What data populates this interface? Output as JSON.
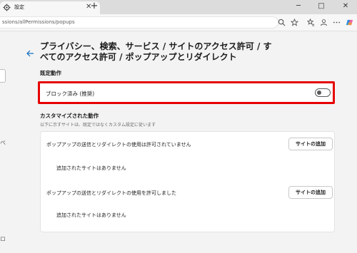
{
  "tab": {
    "title": "設定",
    "close": "✕",
    "new_tab": "+"
  },
  "window_controls": {
    "minimize": "─",
    "maximize": "□",
    "close": "✕"
  },
  "address": {
    "url": "ssions/allPermissions/popups"
  },
  "sidebar": {
    "glyph_1": "ペ",
    "glyph_2": "ロ"
  },
  "page": {
    "heading": "プライバシー、検索、サービス / サイトのアクセス許可 / すべてのアクセス許可 / ポップアップとリダイレクト",
    "default_section_label": "既定動作",
    "block_label": "ブロック済み (推奨)",
    "block_toggle_on": false,
    "custom_section_label": "カスタマイズされた動作",
    "custom_section_sub": "以下に示すサイトは、既定ではなくカスタム設定に従います",
    "rows": [
      {
        "title": "ポップアップの送信とリダイレクトの使用は許可されていません",
        "button": "サイトの追加",
        "empty": "追加されたサイトはありません"
      },
      {
        "title": "ポップアップの送信とリダイレクトの使用を許可しました",
        "button": "サイトの追加",
        "empty": "追加されたサイトはありません"
      }
    ]
  },
  "colors": {
    "highlight": "#e60000",
    "accent": "#0f6cbd"
  }
}
